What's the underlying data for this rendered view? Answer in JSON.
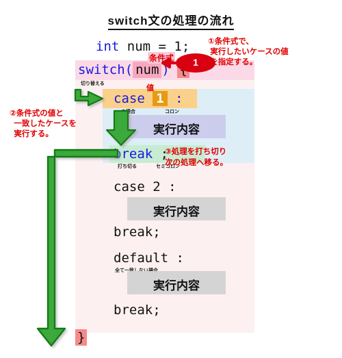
{
  "title": "switch文の処理の流れ",
  "code": {
    "line_int": "int num = 1;",
    "kw_int": "int",
    "rest_int": " num = 1;",
    "switch_kw": "switch(",
    "switch_arg": "num",
    "switch_paren": ")",
    "switch_brace": "{",
    "switch_ruby": "切り替える",
    "label_condition": "条件式",
    "case1_kw": "case",
    "case1_value": "1",
    "case1_colon": ":",
    "case1_ruby": "〜の場合",
    "case1_colon_ruby": "コロン",
    "label_value": "値",
    "exec_label": "実行内容",
    "break_kw": "break",
    "break_semi": ";",
    "break_ruby": "打ち切る",
    "semi_ruby": "セミコロン",
    "case2_line": "case  2 :",
    "break2_line": "break;",
    "default_line": "default :",
    "default_ruby": "全て一致しない場合",
    "break3_line": "break;",
    "closing_brace": "}"
  },
  "annotations": {
    "note1": "①条件式で、\n 実行したいケースの値\n を指定する。",
    "note2": "②条件式の値と\n  一致したケースを\n  実行する。",
    "note3": "③処理を打ち切り\n次の処理へ移る。",
    "bubble_value": "1"
  },
  "colors": {
    "panel_bg": "#fcf0f0",
    "case_zone": "#ddeef7",
    "switch_band": "#fbd9e6",
    "num_highlight": "#f7a8c0",
    "brace_highlight": "#f58a8a",
    "case_band": "#fbd08a",
    "one_highlight": "#e89a12",
    "exec1_bg": "#ccccec",
    "exec_bg": "#d4d4d4",
    "break_band": "#c8ecd3",
    "red": "#e10000",
    "green": "#3aa93a",
    "blue": "#1818e0"
  }
}
